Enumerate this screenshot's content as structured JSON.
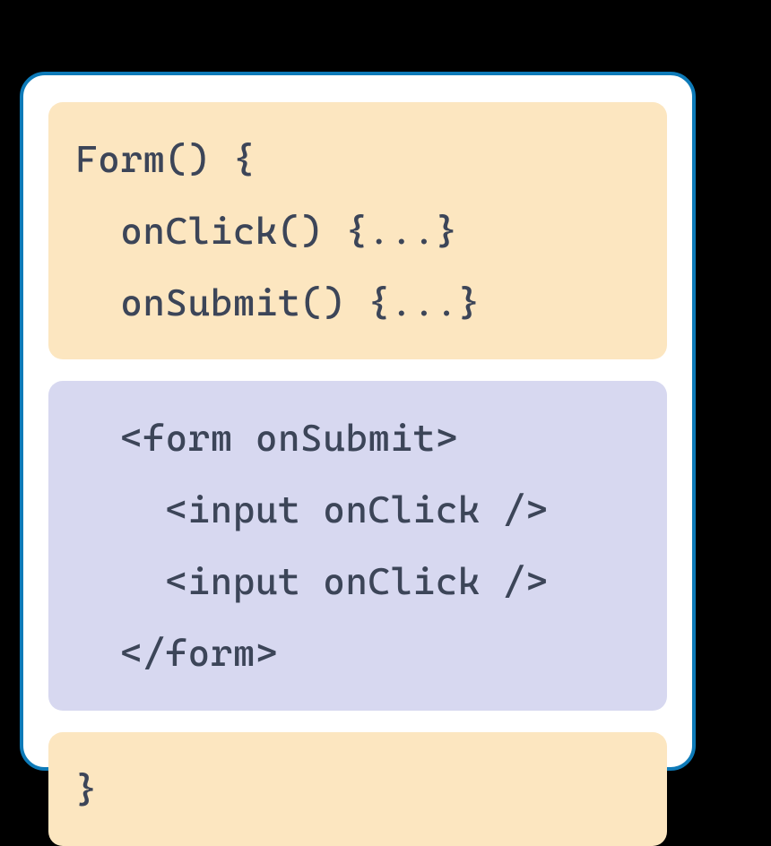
{
  "blocks": {
    "top": {
      "line1": "Form() {",
      "line2": "  onClick() {...}",
      "line3": "  onSubmit() {...}"
    },
    "middle": {
      "line1": "  <form onSubmit>",
      "line2": "    <input onClick />",
      "line3": "    <input onClick />",
      "line4": "  </form>"
    },
    "bottom": {
      "line1": "}"
    }
  }
}
